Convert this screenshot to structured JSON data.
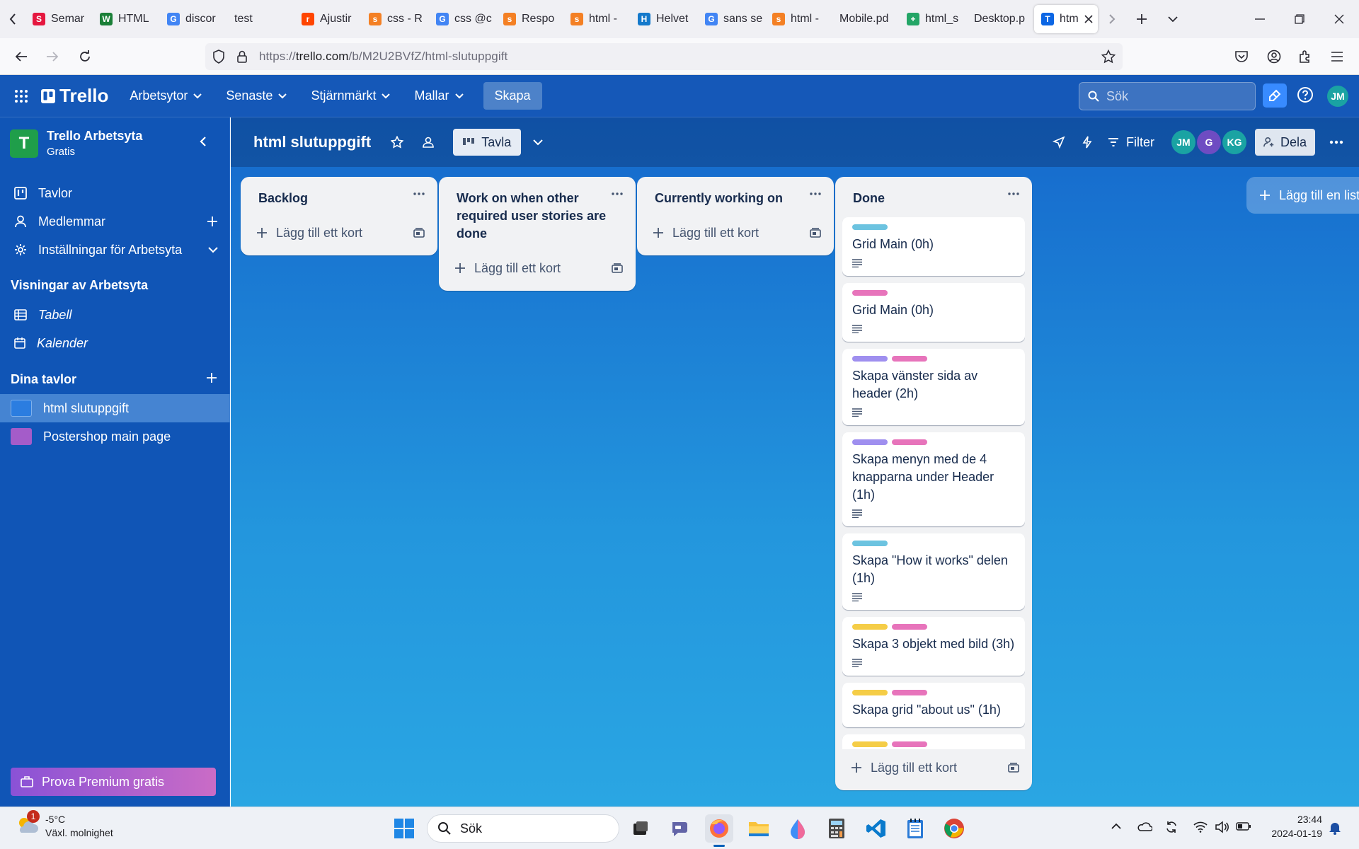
{
  "browser": {
    "tabs": [
      {
        "label": "Semar",
        "color": "#e5173f",
        "glyph": "S"
      },
      {
        "label": "HTML",
        "color": "#1a7f37",
        "glyph": "W"
      },
      {
        "label": "discor",
        "color": "#4285f4",
        "glyph": "G"
      },
      {
        "label": "test",
        "color": "",
        "glyph": ""
      },
      {
        "label": "Ajustir",
        "color": "#ff4500",
        "glyph": "r"
      },
      {
        "label": "css - R",
        "color": "#f48024",
        "glyph": "s"
      },
      {
        "label": "css @c",
        "color": "#4285f4",
        "glyph": "G"
      },
      {
        "label": "Respo",
        "color": "#f48024",
        "glyph": "s"
      },
      {
        "label": "html -",
        "color": "#f48024",
        "glyph": "s"
      },
      {
        "label": "Helvet",
        "color": "#1479cb",
        "glyph": "H"
      },
      {
        "label": "sans se",
        "color": "#4285f4",
        "glyph": "G"
      },
      {
        "label": "html -",
        "color": "#f48024",
        "glyph": "s"
      },
      {
        "label": "Mobile.pd",
        "color": "",
        "glyph": ""
      },
      {
        "label": "html_s",
        "color": "#23a566",
        "glyph": "+"
      },
      {
        "label": "Desktop.p",
        "color": "",
        "glyph": ""
      },
      {
        "label": "htm",
        "color": "#0c66e4",
        "glyph": "T"
      }
    ],
    "url_prefix": "https://",
    "url_host": "trello.com",
    "url_path": "/b/M2U2BVfZ/html-slutuppgift"
  },
  "header": {
    "logo": "Trello",
    "nav": [
      "Arbetsytor",
      "Senaste",
      "Stjärnmärkt",
      "Mallar"
    ],
    "create": "Skapa",
    "search_placeholder": "Sök",
    "user_initials": "JM"
  },
  "sidebar": {
    "workspace_initial": "T",
    "workspace_name": "Trello Arbetsyta",
    "workspace_plan": "Gratis",
    "items": [
      {
        "label": "Tavlor"
      },
      {
        "label": "Medlemmar"
      },
      {
        "label": "Inställningar för Arbetsyta"
      }
    ],
    "views_heading": "Visningar av Arbetsyta",
    "views": [
      {
        "label": "Tabell"
      },
      {
        "label": "Kalender"
      }
    ],
    "boards_heading": "Dina tavlor",
    "boards": [
      {
        "label": "html slutuppgift",
        "color": "#2b7de0"
      },
      {
        "label": "Postershop main page",
        "color": "#a45cc9"
      }
    ],
    "premium": "Prova Premium gratis"
  },
  "board": {
    "title": "html slutuppgift",
    "view": "Tavla",
    "filter": "Filter",
    "members": [
      {
        "initials": "JM",
        "color": "#1aa3a3"
      },
      {
        "initials": "G",
        "color": "#6e4cc2"
      },
      {
        "initials": "KG",
        "color": "#1aa3a3"
      }
    ],
    "share": "Dela",
    "add_card": "Lägg till ett kort",
    "add_list": "Lägg till en lista",
    "lists": [
      {
        "title": "Backlog",
        "cards": []
      },
      {
        "title": "Work on when other required user stories are done",
        "cards": []
      },
      {
        "title": "Currently working on",
        "cards": []
      },
      {
        "title": "Done",
        "cards": [
          {
            "title": "Grid Main (0h)",
            "labels": [
              "#6cc3e0"
            ],
            "desc": true
          },
          {
            "title": "Grid Main (0h)",
            "labels": [
              "#e774bb"
            ],
            "desc": true
          },
          {
            "title": "Skapa vänster sida av header (2h)",
            "labels": [
              "#9f8fef",
              "#e774bb"
            ],
            "desc": true
          },
          {
            "title": "Skapa menyn med de 4 knapparna under Header (1h)",
            "labels": [
              "#9f8fef",
              "#e774bb"
            ],
            "desc": true
          },
          {
            "title": "Skapa \"How it works\" delen (1h)",
            "labels": [
              "#6cc3e0"
            ],
            "desc": true
          },
          {
            "title": "Skapa 3 objekt med bild (3h)",
            "labels": [
              "#f5cd47",
              "#e774bb"
            ],
            "desc": true
          },
          {
            "title": "Skapa grid \"about us\" (1h)",
            "labels": [
              "#f5cd47",
              "#e774bb"
            ],
            "desc": false
          },
          {
            "title": "",
            "labels": [
              "#f5cd47",
              "#e774bb"
            ],
            "desc": false
          }
        ]
      }
    ]
  },
  "taskbar": {
    "weather_temp": "-5°C",
    "weather_text": "Växl. molnighet",
    "weather_badge": "1",
    "search": "Sök",
    "time": "23:44",
    "date": "2024-01-19"
  }
}
